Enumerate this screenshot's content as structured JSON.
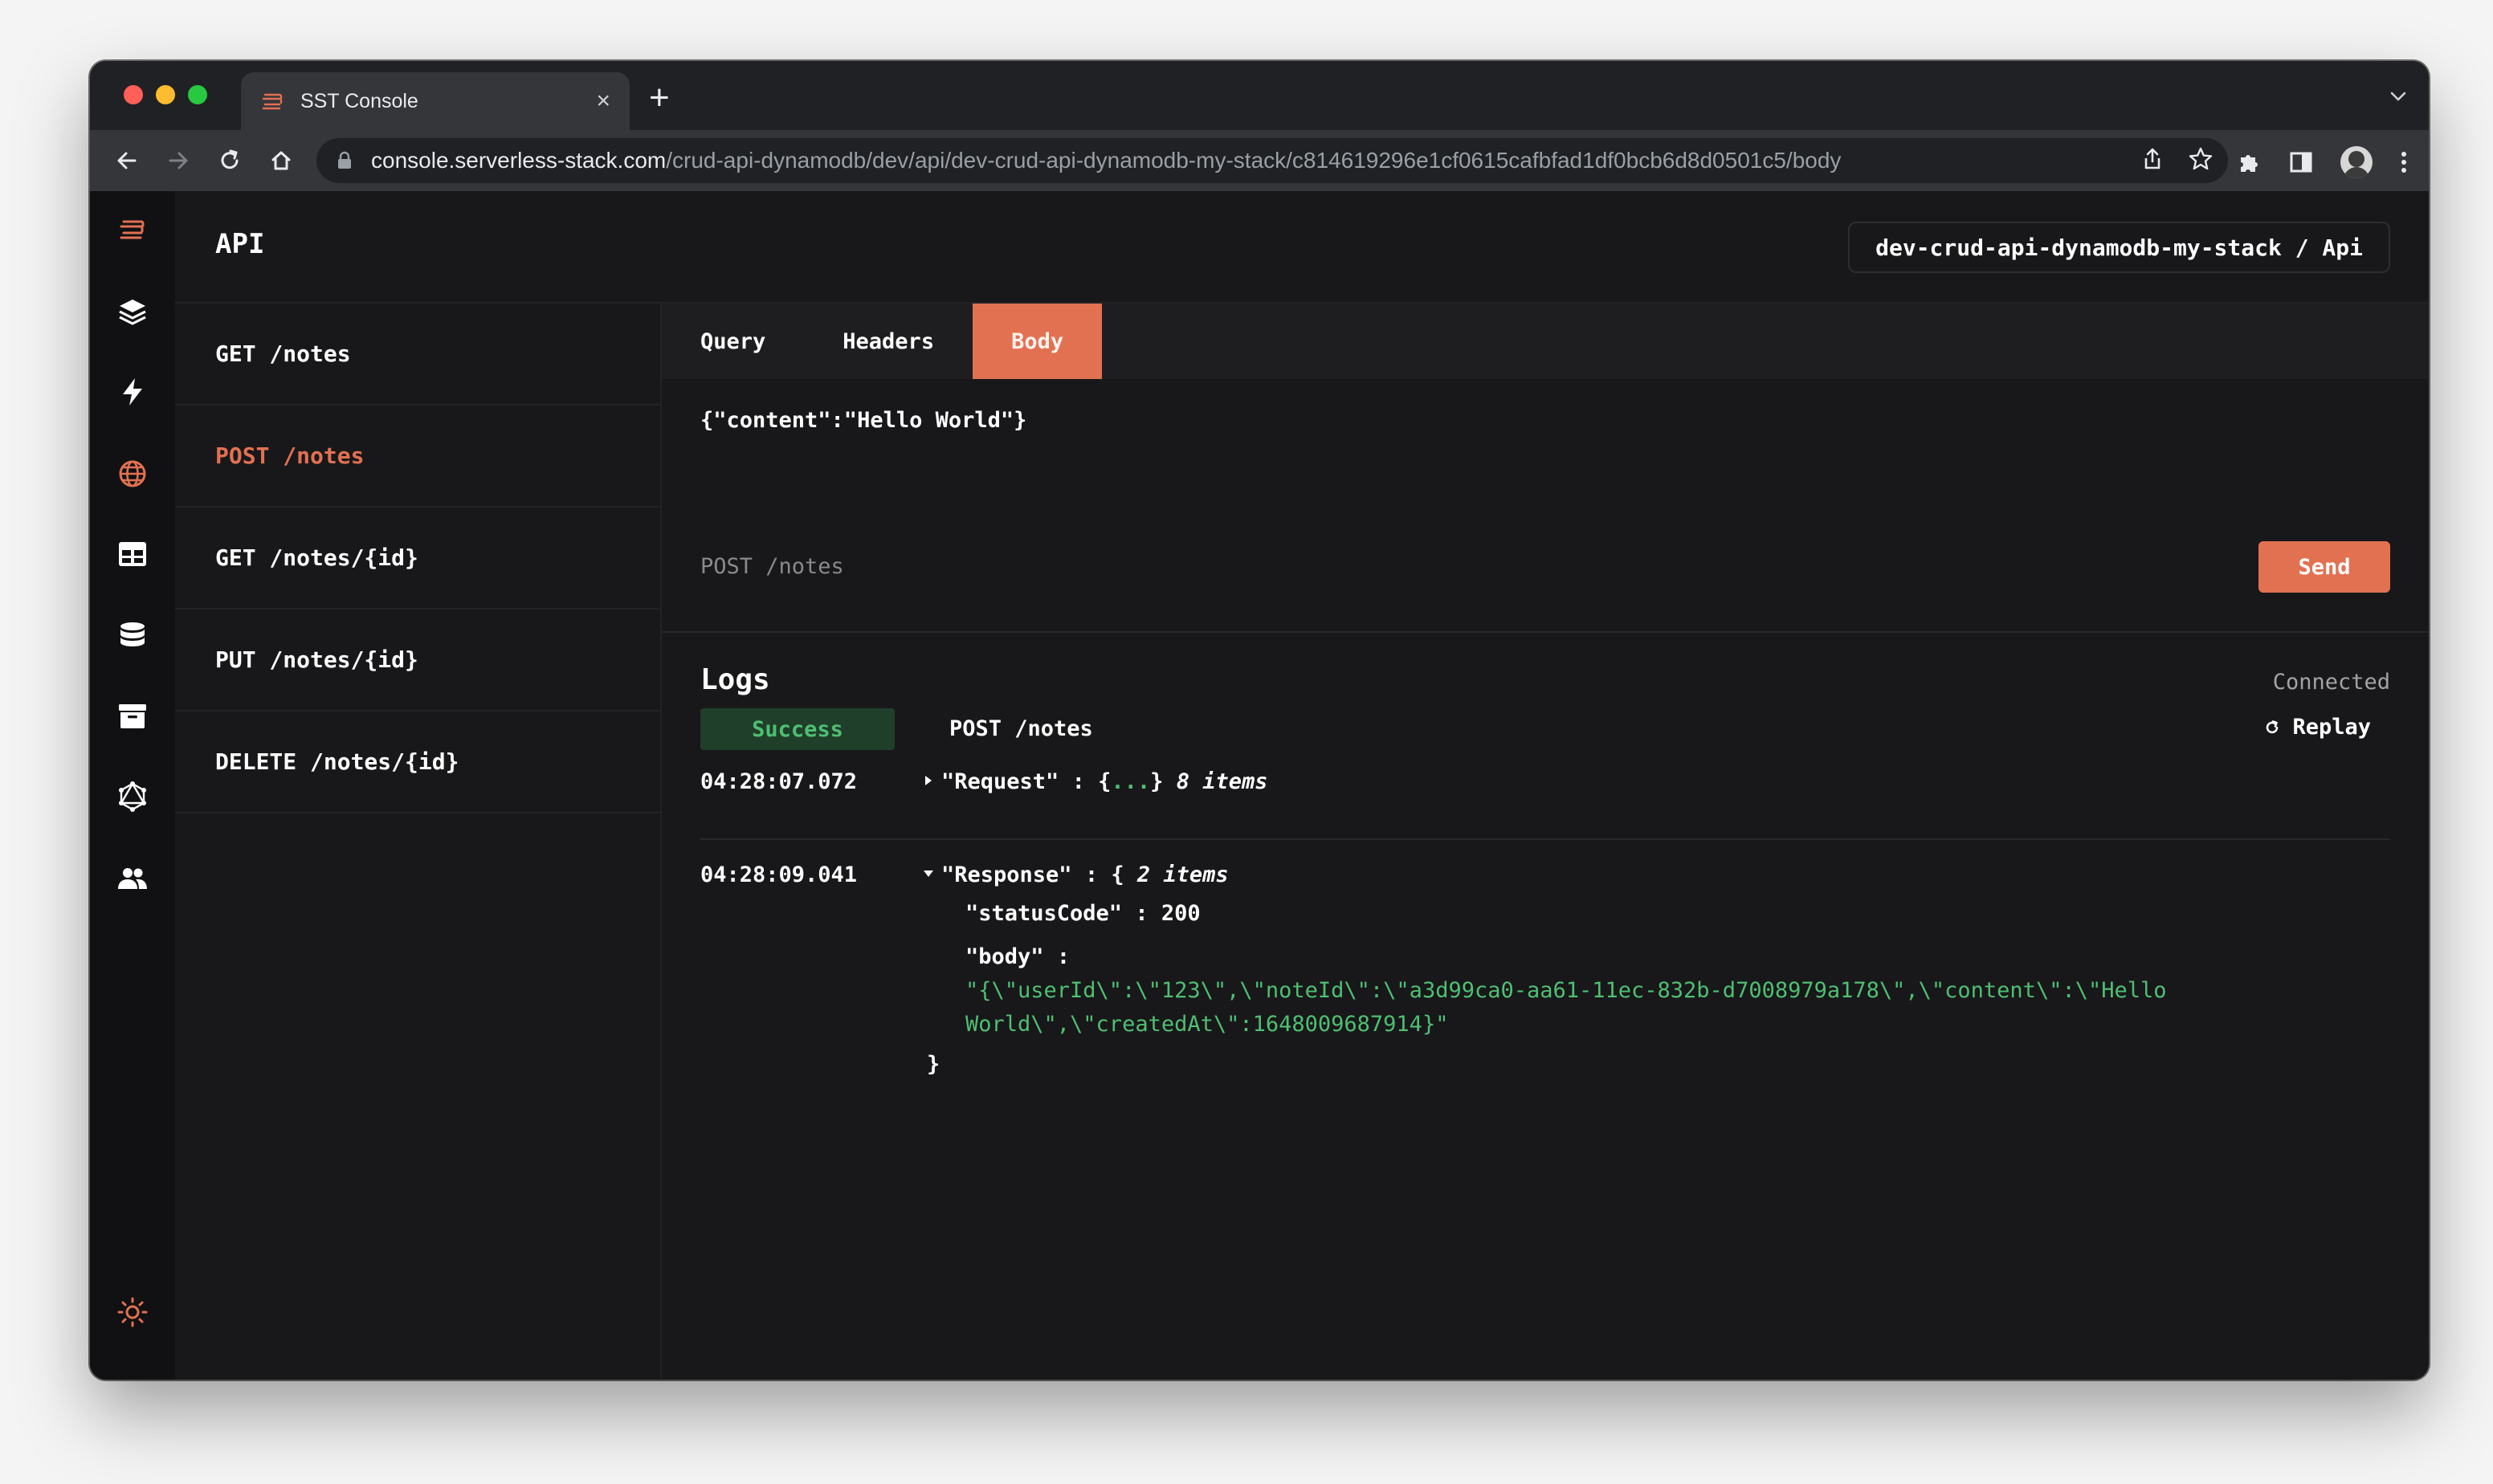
{
  "browser": {
    "tab_title": "SST Console",
    "tab_close": "×",
    "new_tab": "+",
    "url_host": "console.serverless-stack.com",
    "url_path": "/crud-api-dynamodb/dev/api/dev-crud-api-dynamodb-my-stack/c814619296e1cf0615cafbfad1df0bcb6d8d0501c5/body"
  },
  "app": {
    "page_title": "API",
    "stack_badge": "dev-crud-api-dynamodb-my-stack / Api",
    "routes": [
      {
        "label": "GET /notes",
        "active": false
      },
      {
        "label": "POST /notes",
        "active": true
      },
      {
        "label": "GET /notes/{id}",
        "active": false
      },
      {
        "label": "PUT /notes/{id}",
        "active": false
      },
      {
        "label": "DELETE /notes/{id}",
        "active": false
      }
    ],
    "request_tabs": [
      {
        "label": "Query",
        "active": false
      },
      {
        "label": "Headers",
        "active": false
      },
      {
        "label": "Body",
        "active": true
      }
    ],
    "body_value": "{\"content\":\"Hello World\"}",
    "request_summary": "POST /notes",
    "send_label": "Send"
  },
  "logs": {
    "title": "Logs",
    "connection_status": "Connected",
    "status_badge": "Success",
    "route": "POST /notes",
    "replay_label": "Replay",
    "entries": [
      {
        "time": "04:28:07.072",
        "key": "\"Request\"",
        "separator": ":",
        "open_brace": "{",
        "ellipsis": "...",
        "close_brace": "}",
        "count": "8 items",
        "expanded": false
      },
      {
        "time": "04:28:09.041",
        "key": "\"Response\"",
        "separator": ":",
        "open_brace": "{",
        "count": "2 items",
        "close_brace": "}",
        "expanded": true,
        "children": [
          {
            "key": "\"statusCode\"",
            "separator": ":",
            "value": "200"
          },
          {
            "key": "\"body\"",
            "separator": ":",
            "value_line1": "\"{\\\"userId\\\":\\\"123\\\",\\\"noteId\\\":\\\"a3d99ca0-aa61-11ec-832b-d7008979a178\\\",\\\"content\\\":\\\"Hello",
            "value_line2": "World\\\",\\\"createdAt\\\":1648009687914}\""
          }
        ]
      }
    ]
  },
  "colors": {
    "accent": "#e27152",
    "success": "#4fbf72",
    "success_bg": "#1f3f2a",
    "background": "#18181a",
    "sidebar": "#111113"
  },
  "icons": {
    "sidebar": [
      "sst-logo-icon",
      "stacks-icon",
      "functions-icon",
      "api-globe-icon",
      "dynamodb-table-icon",
      "rds-database-icon",
      "buckets-icon",
      "graphql-icon",
      "cognito-users-icon",
      "theme-sun-icon",
      "expand-arrow-icon"
    ]
  }
}
